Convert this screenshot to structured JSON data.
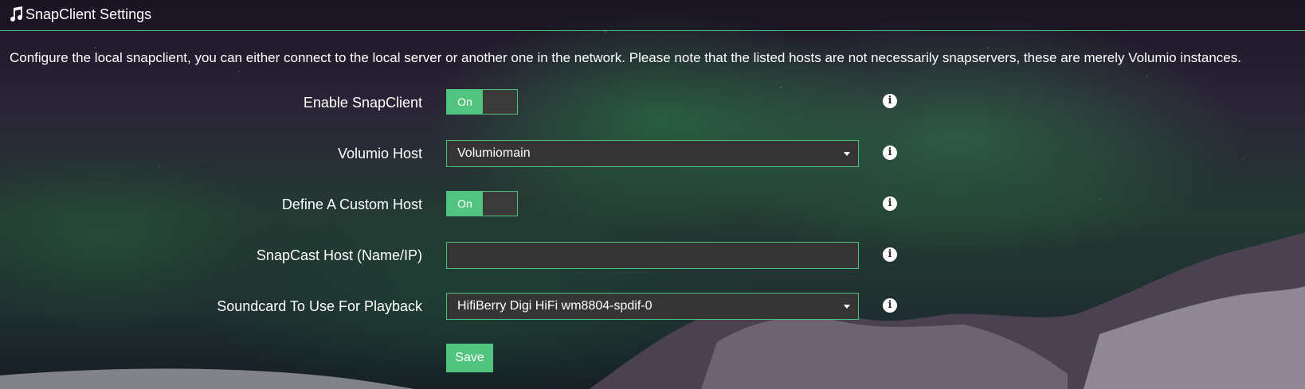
{
  "header": {
    "title": "SnapClient Settings",
    "icon": "music-note-icon"
  },
  "description": "Configure the local snapclient, you can either connect to the local server or another one in the network. Please note that the listed hosts are not necessarily snapservers, these are merely Volumio instances.",
  "settings": {
    "enable_snapclient": {
      "label": "Enable SnapClient",
      "state": "On"
    },
    "volumio_host": {
      "label": "Volumio Host",
      "value": "Volumiomain"
    },
    "custom_host": {
      "label": "Define A Custom Host",
      "state": "On"
    },
    "snapcast_host": {
      "label": "SnapCast Host (Name/IP)",
      "value": ""
    },
    "soundcard": {
      "label": "Soundcard To Use For Playback",
      "value": "HifiBerry Digi HiFi wm8804-spdif-0"
    }
  },
  "info_icon": "i",
  "save_label": "Save",
  "colors": {
    "accent": "#52c47f",
    "field_bg": "#353535"
  }
}
